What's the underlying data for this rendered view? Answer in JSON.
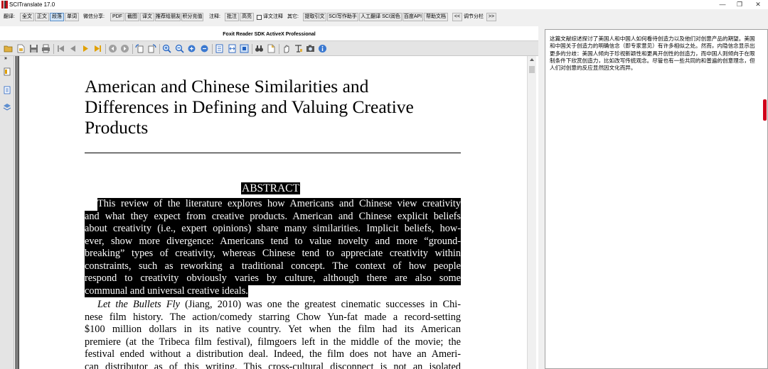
{
  "window": {
    "title": "SCITranslate 17.0",
    "controls": [
      "—",
      "❐",
      "✕"
    ]
  },
  "commandbar": {
    "translate_label": "翻译:",
    "translate_buttons": [
      "全文",
      "正文",
      "段落",
      "单词"
    ],
    "active_translate": "段落",
    "share_label": "微信分享:",
    "share_buttons": [
      "PDF",
      "截图",
      "译文",
      "推荐给朋友",
      "积分充值"
    ],
    "note_label": "注释:",
    "note_buttons": [
      "批注",
      "高亮"
    ],
    "note_checkbox_label": "译文注释",
    "other_label": "其它:",
    "other_buttons": [
      "提取引文",
      "SCI写作助手",
      "人工翻译 SCI润色",
      "百度API",
      "帮助文档"
    ],
    "layout_left": "<<",
    "layout_label": "调节分栏",
    "layout_right": ">>"
  },
  "viewer": {
    "title": "Foxit Reader SDK ActiveX Professional",
    "collapse_glyph": "»",
    "toolbar_icons": [
      "open-folder-icon",
      "open-file-icon",
      "save-icon",
      "print-icon",
      "first-page-icon",
      "previous-page-icon",
      "next-page-icon",
      "last-page-icon",
      "back-icon",
      "forward-icon",
      "rotate-left-icon",
      "rotate-right-icon",
      "zoom-in-icon",
      "zoom-out-icon",
      "zoom-circle-in-icon",
      "zoom-circle-out-icon",
      "fit-page-icon",
      "fit-width-icon",
      "actual-size-icon",
      "find-icon",
      "bookmark-page-icon",
      "hand-tool-icon",
      "text-select-icon",
      "snapshot-icon",
      "about-icon"
    ]
  },
  "document": {
    "title_lines": [
      "American and Chinese Similarities and",
      "Differences in Defining and Valuing Creative",
      "Products"
    ],
    "abstract_heading": "ABSTRACT",
    "abstract_lines": [
      "This review of the literature explores how Americans and Chinese view creativity",
      "and what they expect from creative products. American and Chinese explicit beliefs",
      "about creativity (i.e., expert opinions) share many similarities. Implicit beliefs, how-",
      "ever, show more divergence: Americans tend to value novelty and more “ground-",
      "breaking” types of creativity, whereas Chinese tend to appreciate creativity within",
      "constraints, such as reworking a traditional concept. The context of how people",
      "respond to creativity obviously varies by culture, although there are also some",
      "communal and universal creative ideals."
    ],
    "body_first_italic": "Let the Bullets Fly",
    "body_first_rest": " (Jiang, 2010) was one the greatest cinematic successes in Chi-",
    "body_lines": [
      "nese film history. The action/comedy starring Chow Yun-fat made a record-setting",
      "$100 million dollars in its native country. Yet when the film had its American",
      "premiere (at the Tribeca film festival), filmgoers left in the middle of the movie; the",
      "festival ended without a distribution deal. Indeed, the film does not have an Ameri-",
      "can distributor as of this writing. This cross-cultural disconnect is not an isolated"
    ]
  },
  "translation": {
    "text": "这篇文献综述探讨了美国人和中国人如何看待创造力以及他们对创意产品的期望。美国和中国关于创造力的明确信念（即专家意见）有许多相似之处。然而，内隐信念显示出更多的分歧：美国人倾向于珍视新颖性和更具开创性的创造力，而中国人则倾向于在限制条件下欣赏创造力，比如改写传统观念。尽管也有一些共同的和普遍的创意理念，但人们对创意的反应显然因文化而异。"
  },
  "colors": {
    "accent": "#c0101a",
    "selection_bg": "#000000",
    "selection_fg": "#ffffff"
  }
}
